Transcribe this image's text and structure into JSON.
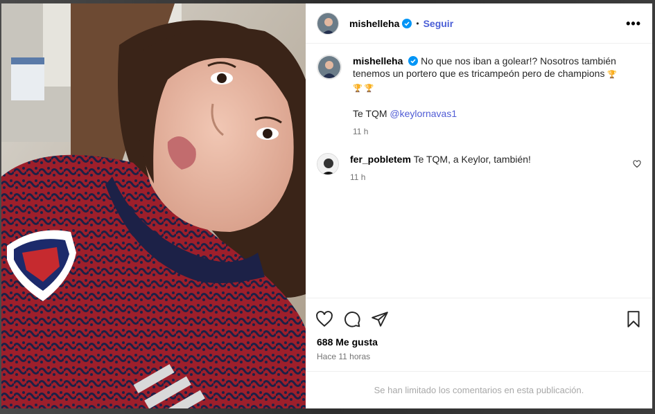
{
  "post": {
    "photo_alt": "selfie in Costa Rica jersey",
    "header": {
      "username": "mishelleha",
      "separator": "•",
      "follow_label": "Seguir",
      "more_label": "•••"
    },
    "caption": {
      "username": "mishelleha",
      "text": "No que nos iban a golear!? Nosotros también tenemos un portero que es tricampeón pero de champions",
      "emoji_1": "🏆",
      "emoji_line": "🏆 🏆",
      "second_line_prefix": "Te TQM ",
      "mention": "@keylornavas1",
      "time": "11 h"
    },
    "comments": [
      {
        "username": "fer_pobletem",
        "text": "Te TQM, a Keylor, también!",
        "time": "11 h"
      }
    ],
    "likes_text": "688 Me gusta",
    "posted_ago": "Hace 11 horas",
    "limited_notice": "Se han limitado los comentarios en esta publicación."
  },
  "icons": {
    "verified": "verified-badge-icon",
    "like": "heart-icon",
    "comment": "comment-bubble-icon",
    "share": "paper-plane-icon",
    "save": "bookmark-icon",
    "more": "more-options-icon"
  },
  "colors": {
    "follow": "#4a5ed6",
    "verified": "#0095f6",
    "muted": "#737373",
    "jersey_red": "#b3262d",
    "jersey_navy": "#1c2147"
  }
}
